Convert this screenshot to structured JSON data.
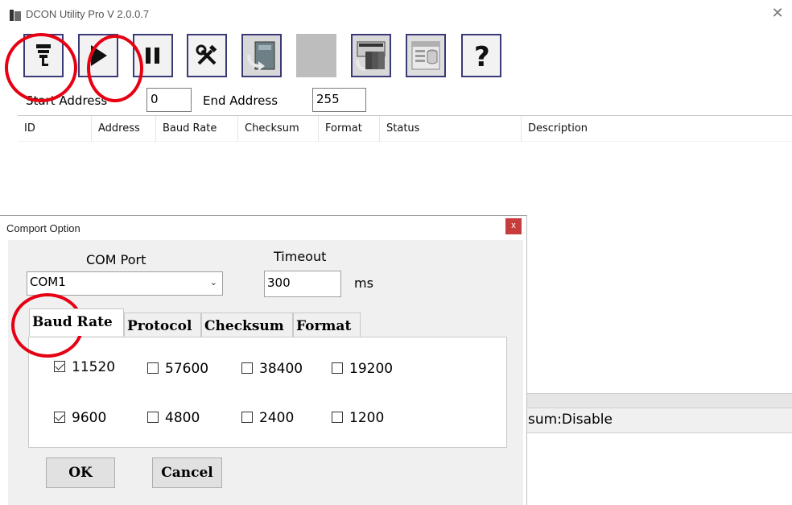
{
  "window": {
    "title": "DCON Utility Pro V 2.0.0.7"
  },
  "toolbar": {
    "buttons": [
      {
        "icon": "com-port-icon"
      },
      {
        "icon": "play-icon"
      },
      {
        "icon": "pause-icon"
      },
      {
        "icon": "tools-icon"
      },
      {
        "icon": "module-refresh-icon"
      },
      {
        "icon": "disabled-icon"
      },
      {
        "icon": "module-scan-icon"
      },
      {
        "icon": "window-db-icon"
      },
      {
        "icon": "help-icon"
      }
    ]
  },
  "address": {
    "start_label": "Start Address",
    "start_value": "0",
    "end_label": "End Address",
    "end_value": "255"
  },
  "list": {
    "columns": [
      "ID",
      "Address",
      "Baud Rate",
      "Checksum",
      "Format",
      "Status",
      "Description"
    ]
  },
  "statusbar": {
    "text": "sum:Disable"
  },
  "dialog": {
    "title": "Comport Option",
    "close": "x",
    "com_port_label": "COM Port",
    "com_port_value": "COM1",
    "timeout_label": "Timeout",
    "timeout_value": "300",
    "timeout_unit": "ms",
    "tabs": [
      "Baud Rate",
      "Protocol",
      "Checksum",
      "Format"
    ],
    "active_tab": "Baud Rate",
    "baud_rates": [
      {
        "label": "11520",
        "checked": true
      },
      {
        "label": "57600",
        "checked": false
      },
      {
        "label": "38400",
        "checked": false
      },
      {
        "label": "19200",
        "checked": false
      },
      {
        "label": "9600",
        "checked": true
      },
      {
        "label": "4800",
        "checked": false
      },
      {
        "label": "2400",
        "checked": false
      },
      {
        "label": "1200",
        "checked": false
      }
    ],
    "ok_label": "OK",
    "cancel_label": "Cancel"
  },
  "colors": {
    "annotation": "#e60012",
    "toolbar_border": "#3a3a78",
    "close_button": "#c73d3d"
  }
}
